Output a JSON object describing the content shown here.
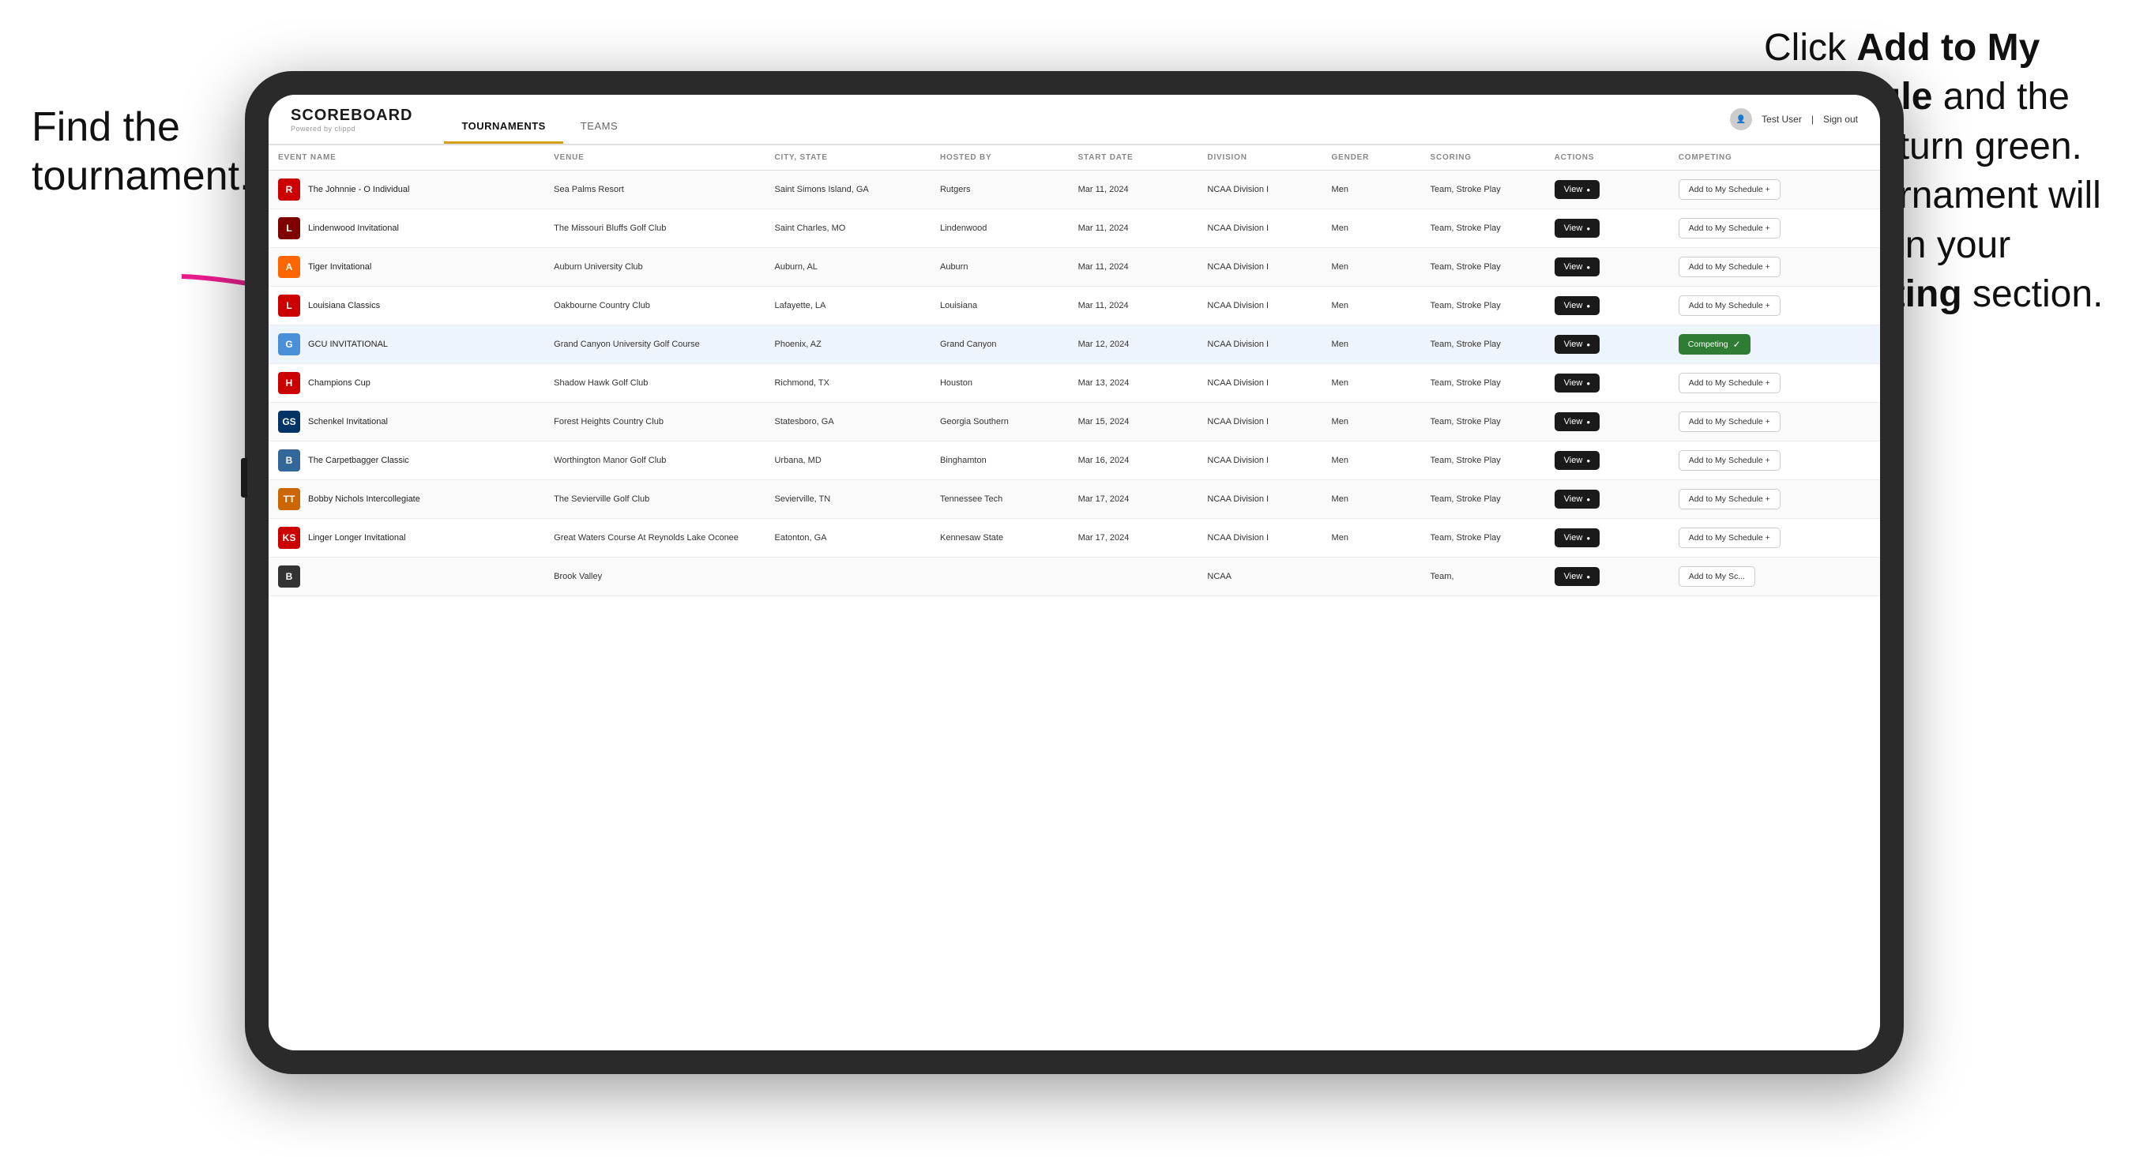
{
  "annotations": {
    "left": "Find the tournament.",
    "right_line1": "Click ",
    "right_bold1": "Add to My Schedule",
    "right_line2": " and the box will turn green. This tournament will now be in your ",
    "right_bold2": "Competing",
    "right_line3": " section."
  },
  "app": {
    "logo": "SCOREBOARD",
    "logo_sub": "Powered by clippd",
    "nav": [
      "TOURNAMENTS",
      "TEAMS"
    ],
    "active_nav": "TOURNAMENTS",
    "user": "Test User",
    "sign_out": "Sign out"
  },
  "table": {
    "columns": [
      "EVENT NAME",
      "VENUE",
      "CITY, STATE",
      "HOSTED BY",
      "START DATE",
      "DIVISION",
      "GENDER",
      "SCORING",
      "ACTIONS",
      "COMPETING"
    ],
    "rows": [
      {
        "logo_text": "R",
        "logo_bg": "#cc0000",
        "event": "The Johnnie - O Individual",
        "venue": "Sea Palms Resort",
        "city": "Saint Simons Island, GA",
        "hosted_by": "Rutgers",
        "start_date": "Mar 11, 2024",
        "division": "NCAA Division I",
        "gender": "Men",
        "scoring": "Team, Stroke Play",
        "highlighted": false,
        "competing": false
      },
      {
        "logo_text": "L",
        "logo_bg": "#800000",
        "event": "Lindenwood Invitational",
        "venue": "The Missouri Bluffs Golf Club",
        "city": "Saint Charles, MO",
        "hosted_by": "Lindenwood",
        "start_date": "Mar 11, 2024",
        "division": "NCAA Division I",
        "gender": "Men",
        "scoring": "Team, Stroke Play",
        "highlighted": false,
        "competing": false
      },
      {
        "logo_text": "A",
        "logo_bg": "#ff6600",
        "event": "Tiger Invitational",
        "venue": "Auburn University Club",
        "city": "Auburn, AL",
        "hosted_by": "Auburn",
        "start_date": "Mar 11, 2024",
        "division": "NCAA Division I",
        "gender": "Men",
        "scoring": "Team, Stroke Play",
        "highlighted": false,
        "competing": false
      },
      {
        "logo_text": "L",
        "logo_bg": "#cc0000",
        "event": "Louisiana Classics",
        "venue": "Oakbourne Country Club",
        "city": "Lafayette, LA",
        "hosted_by": "Louisiana",
        "start_date": "Mar 11, 2024",
        "division": "NCAA Division I",
        "gender": "Men",
        "scoring": "Team, Stroke Play",
        "highlighted": false,
        "competing": false
      },
      {
        "logo_text": "G",
        "logo_bg": "#4a90d9",
        "event": "GCU INVITATIONAL",
        "venue": "Grand Canyon University Golf Course",
        "city": "Phoenix, AZ",
        "hosted_by": "Grand Canyon",
        "start_date": "Mar 12, 2024",
        "division": "NCAA Division I",
        "gender": "Men",
        "scoring": "Team, Stroke Play",
        "highlighted": true,
        "competing": true
      },
      {
        "logo_text": "H",
        "logo_bg": "#cc0000",
        "event": "Champions Cup",
        "venue": "Shadow Hawk Golf Club",
        "city": "Richmond, TX",
        "hosted_by": "Houston",
        "start_date": "Mar 13, 2024",
        "division": "NCAA Division I",
        "gender": "Men",
        "scoring": "Team, Stroke Play",
        "highlighted": false,
        "competing": false
      },
      {
        "logo_text": "GS",
        "logo_bg": "#003366",
        "event": "Schenkel Invitational",
        "venue": "Forest Heights Country Club",
        "city": "Statesboro, GA",
        "hosted_by": "Georgia Southern",
        "start_date": "Mar 15, 2024",
        "division": "NCAA Division I",
        "gender": "Men",
        "scoring": "Team, Stroke Play",
        "highlighted": false,
        "competing": false
      },
      {
        "logo_text": "B",
        "logo_bg": "#336699",
        "event": "The Carpetbagger Classic",
        "venue": "Worthington Manor Golf Club",
        "city": "Urbana, MD",
        "hosted_by": "Binghamton",
        "start_date": "Mar 16, 2024",
        "division": "NCAA Division I",
        "gender": "Men",
        "scoring": "Team, Stroke Play",
        "highlighted": false,
        "competing": false
      },
      {
        "logo_text": "TT",
        "logo_bg": "#cc6600",
        "event": "Bobby Nichols Intercollegiate",
        "venue": "The Sevierville Golf Club",
        "city": "Sevierville, TN",
        "hosted_by": "Tennessee Tech",
        "start_date": "Mar 17, 2024",
        "division": "NCAA Division I",
        "gender": "Men",
        "scoring": "Team, Stroke Play",
        "highlighted": false,
        "competing": false
      },
      {
        "logo_text": "KS",
        "logo_bg": "#cc0000",
        "event": "Linger Longer Invitational",
        "venue": "Great Waters Course At Reynolds Lake Oconee",
        "city": "Eatonton, GA",
        "hosted_by": "Kennesaw State",
        "start_date": "Mar 17, 2024",
        "division": "NCAA Division I",
        "gender": "Men",
        "scoring": "Team, Stroke Play",
        "highlighted": false,
        "competing": false
      },
      {
        "logo_text": "B",
        "logo_bg": "#333",
        "event": "",
        "venue": "Brook Valley",
        "city": "",
        "hosted_by": "",
        "start_date": "",
        "division": "NCAA",
        "gender": "",
        "scoring": "Team,",
        "highlighted": false,
        "competing": false,
        "partial": true
      }
    ],
    "view_btn_label": "View",
    "add_schedule_label": "Add to My Schedule +",
    "competing_label": "Competing"
  }
}
